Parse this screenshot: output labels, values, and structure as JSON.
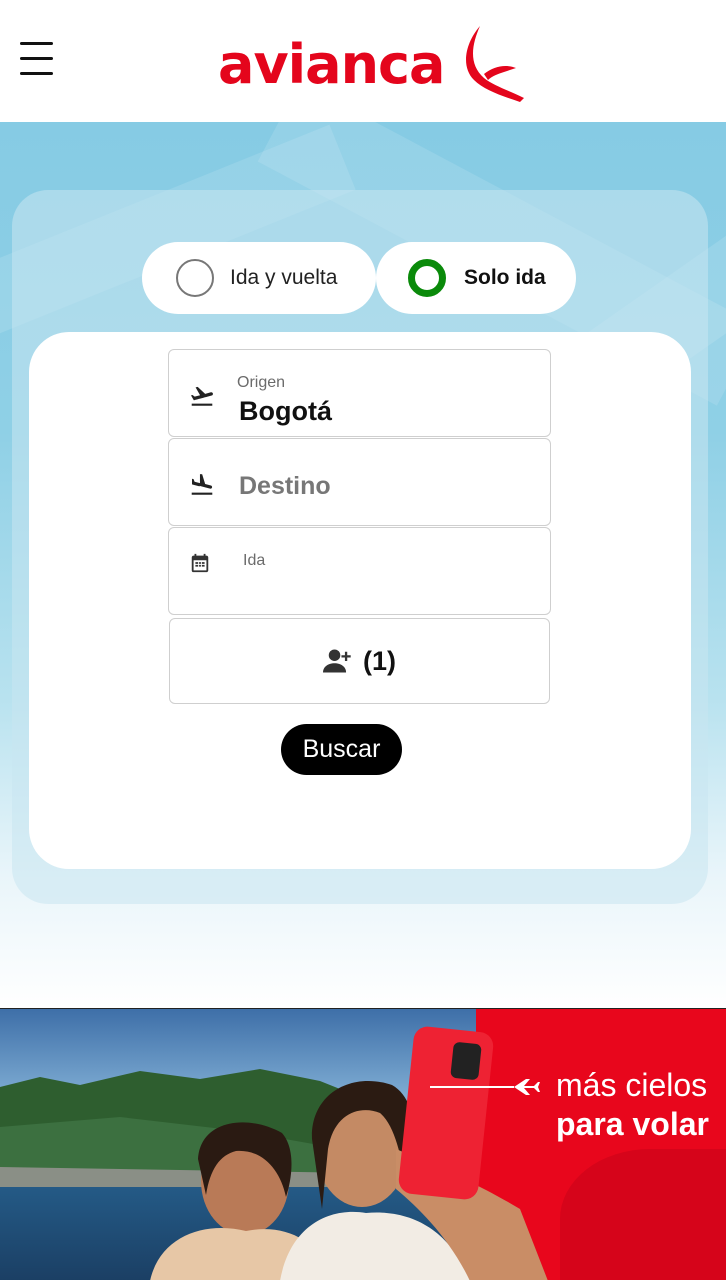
{
  "header": {
    "brand": "avianca",
    "menu_icon": "hamburger-menu-icon",
    "brand_color": "#e4051c"
  },
  "trip_type": {
    "options": [
      {
        "label": "Ida y vuelta",
        "selected": false
      },
      {
        "label": "Solo ida",
        "selected": true
      }
    ],
    "selected_color": "#0a8a0a"
  },
  "form": {
    "origin": {
      "label": "Origen",
      "value": "Bogotá",
      "icon": "plane-takeoff-icon"
    },
    "destination": {
      "placeholder": "Destino",
      "icon": "plane-landing-icon"
    },
    "departure": {
      "label": "Ida",
      "icon": "calendar-icon"
    },
    "passengers": {
      "count": "(1)",
      "icon": "add-person-icon"
    },
    "search_label": "Buscar"
  },
  "banner": {
    "line1": "más cielos",
    "line2": "para volar",
    "accent_color": "#e8061c"
  }
}
